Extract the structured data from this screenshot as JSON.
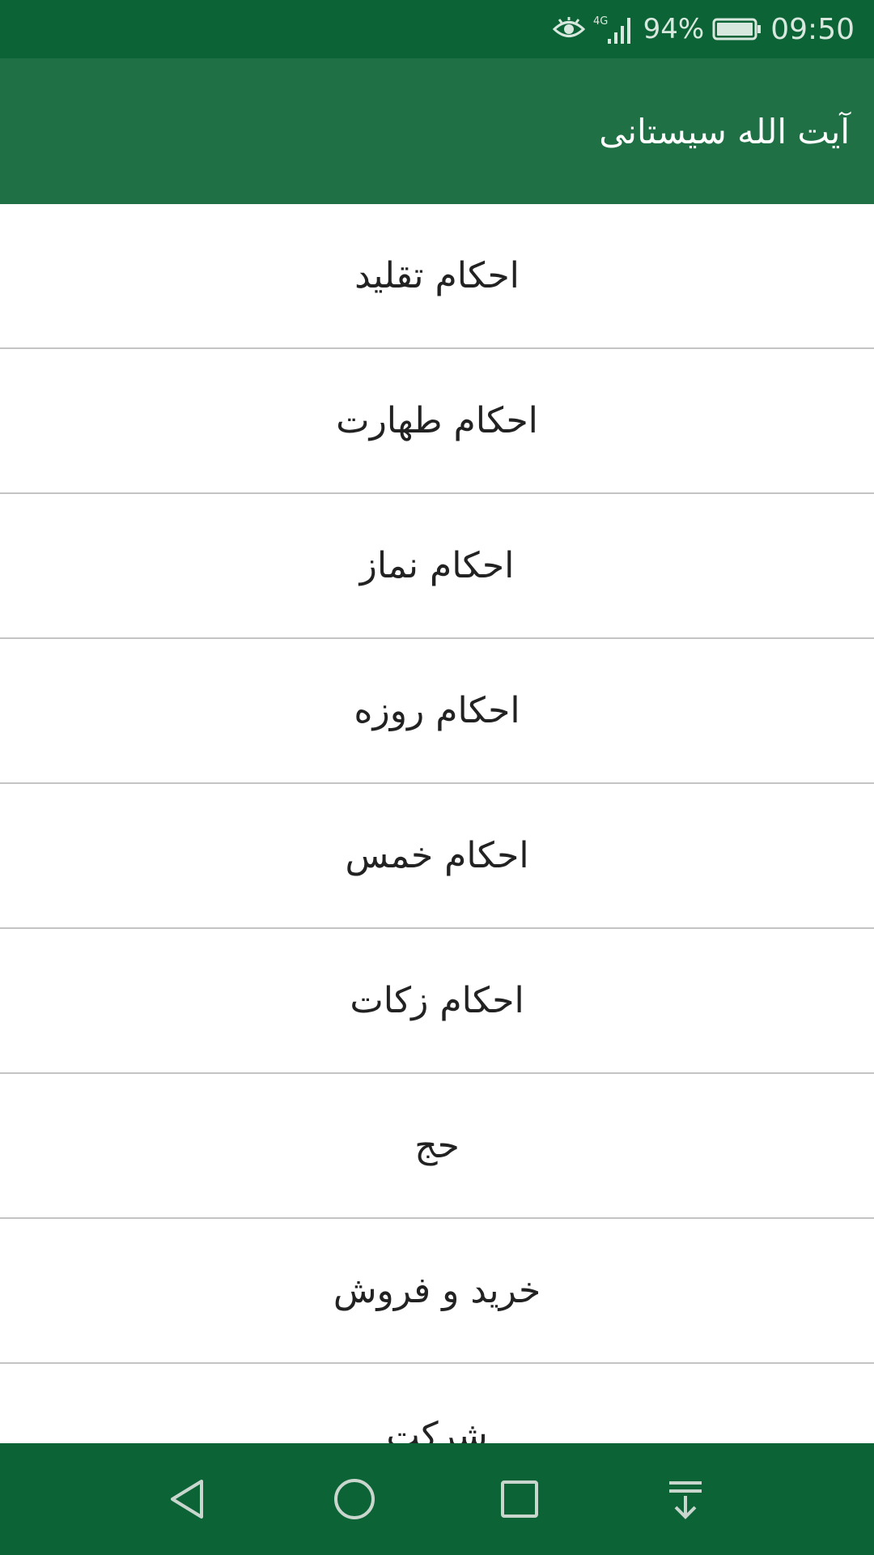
{
  "status_bar": {
    "network": "4G",
    "battery": "94%",
    "time": "09:50",
    "icons": [
      "eye-comfort-icon",
      "signal-icon",
      "battery-icon"
    ]
  },
  "app_bar": {
    "title": "آیت الله سیستانی"
  },
  "list": {
    "items": [
      {
        "label": "احکام تقلید"
      },
      {
        "label": "احکام طهارت"
      },
      {
        "label": "احکام نماز"
      },
      {
        "label": "احکام روزه"
      },
      {
        "label": "احکام خمس"
      },
      {
        "label": "احکام زکات"
      },
      {
        "label": "حج"
      },
      {
        "label": "خرید و فروش"
      },
      {
        "label": "شرکت"
      }
    ]
  },
  "nav_bar": {
    "icons": [
      "back-icon",
      "home-icon",
      "recents-icon",
      "notification-pull-icon"
    ]
  },
  "colors": {
    "status_bar": "#0b6336",
    "app_bar": "#1f7045",
    "nav_bar": "#0b6336",
    "divider": "#c4c4c4",
    "list_text": "#222222"
  }
}
